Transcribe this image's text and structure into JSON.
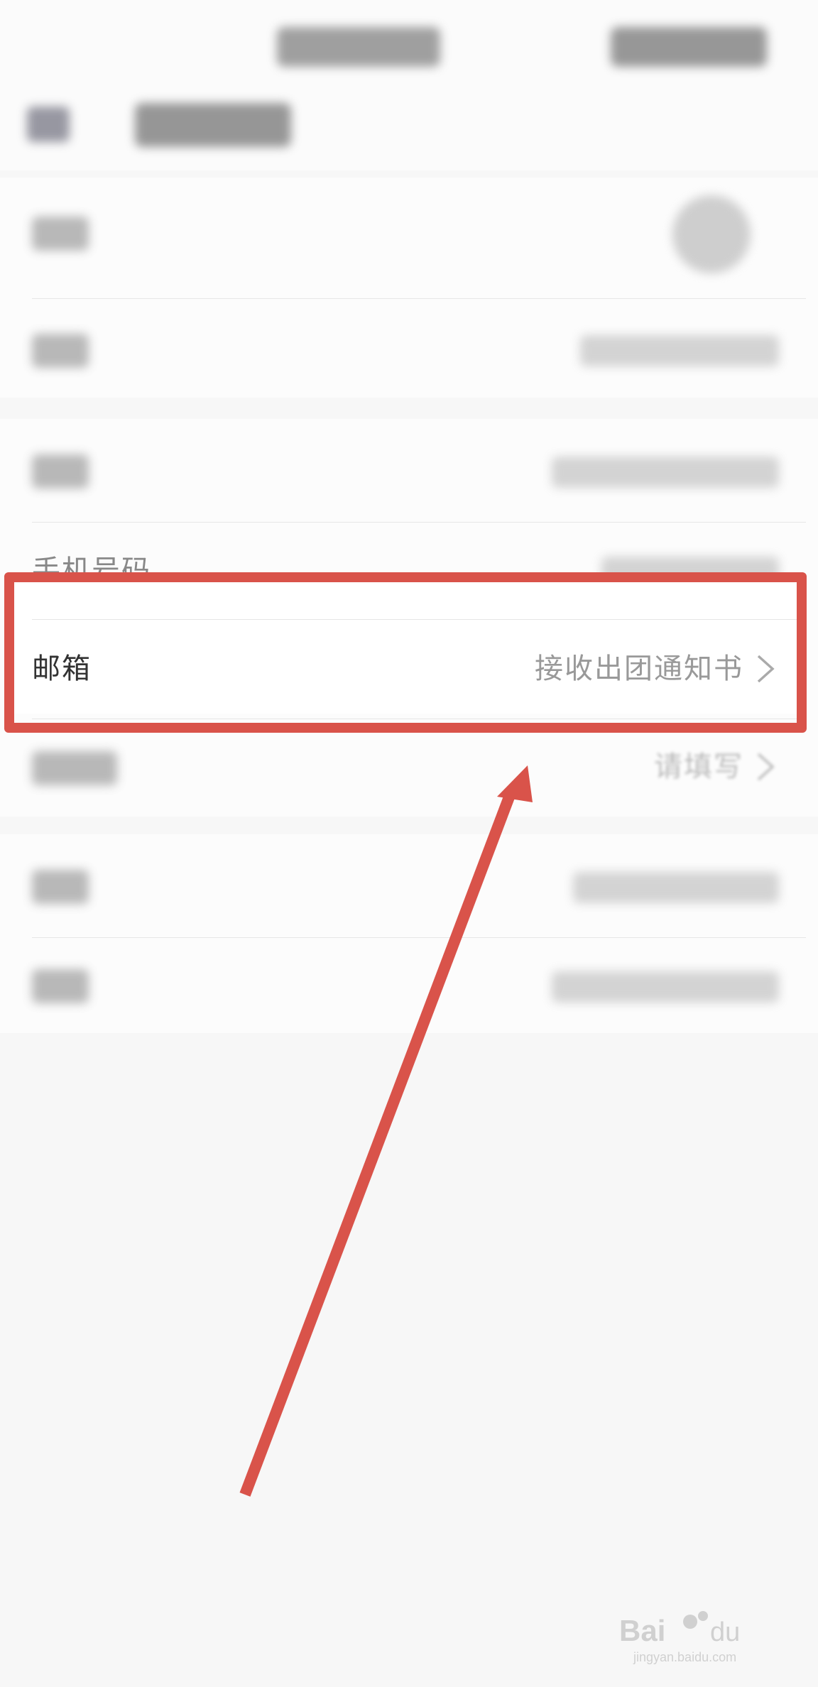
{
  "email_row": {
    "label": "邮箱",
    "value": "接收出团通知书"
  },
  "phone_row": {
    "label": "手机号码"
  },
  "next_row": {
    "value": "请填写"
  },
  "watermark": {
    "brand": "Baidu经验",
    "url": "jingyan.baidu.com"
  },
  "colors": {
    "highlight": "#d9534a",
    "background": "#f7f7f7"
  }
}
